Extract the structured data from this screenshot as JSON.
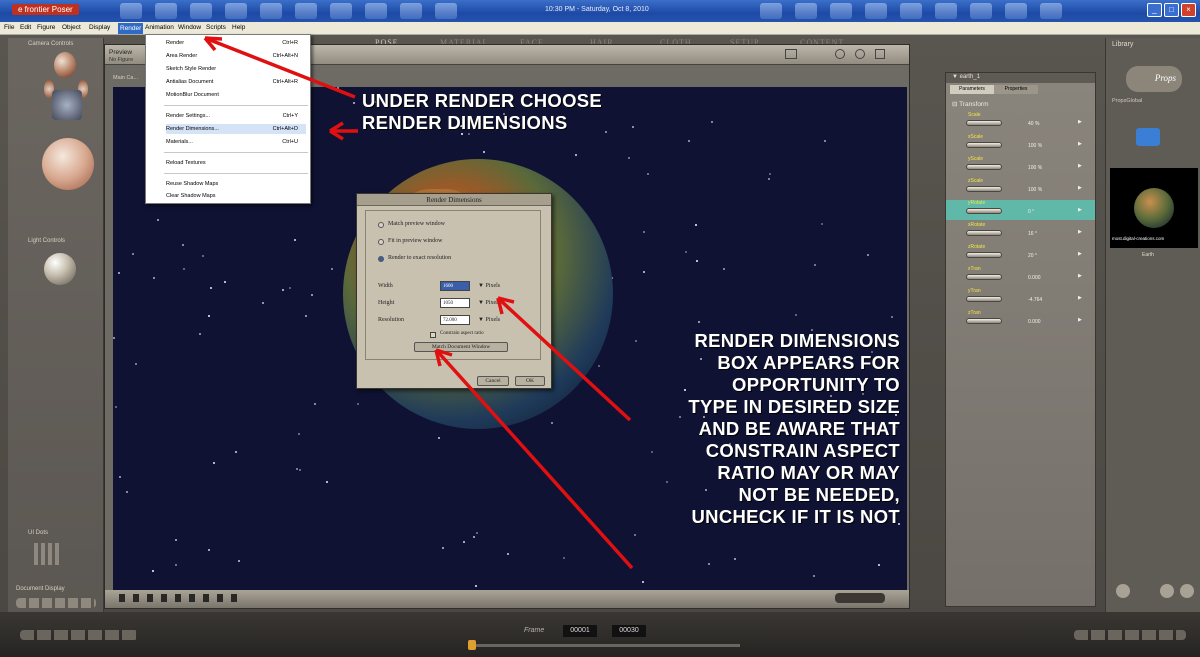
{
  "titlebar": {
    "title": "e frontier Poser",
    "clock": "10:30 PM - Saturday, Oct 8, 2010"
  },
  "menubar": {
    "items": [
      "File",
      "Edit",
      "Figure",
      "Object",
      "Display",
      "Render",
      "Animation",
      "Window",
      "Scripts",
      "Help"
    ]
  },
  "room_tabs": [
    "POSE",
    "MATERIAL",
    "FACE",
    "HAIR",
    "CLOTH",
    "SETUP",
    "CONTENT"
  ],
  "left_panel": {
    "camera_controls": "Camera Controls",
    "light_controls": "Light Controls",
    "ui_dots": "UI Dots",
    "document_display": "Document Display"
  },
  "document": {
    "tab": "Preview",
    "sub": "No Figure",
    "camera": "Main Ca..."
  },
  "render_menu": {
    "items": [
      {
        "label": "Render",
        "shortcut": "Ctrl+R"
      },
      {
        "label": "Area Render",
        "shortcut": "Ctrl+Alt+N"
      },
      {
        "label": "Sketch Style Render",
        "shortcut": ""
      },
      {
        "label": "Antialias Document",
        "shortcut": "Ctrl+Alt+R"
      },
      {
        "label": "MotionBlur Document",
        "shortcut": ""
      },
      {
        "label": "Render Settings...",
        "shortcut": "Ctrl+Y"
      },
      {
        "label": "Render Dimensions...",
        "shortcut": "Ctrl+Alt+D"
      },
      {
        "label": "Materials...",
        "shortcut": "Ctrl+U"
      },
      {
        "label": "Reload Textures",
        "shortcut": ""
      },
      {
        "label": "Reuse Shadow Maps",
        "shortcut": ""
      },
      {
        "label": "Clear Shadow Maps",
        "shortcut": ""
      }
    ]
  },
  "dialog": {
    "title": "Render Dimensions",
    "opt_match": "Match preview window",
    "opt_fit": "Fit in preview window",
    "opt_exact": "Render to exact resolution",
    "width_label": "Width",
    "width_value": "1600",
    "height_label": "Height",
    "height_value": "1050",
    "resolution_label": "Resolution",
    "resolution_value": "72.000",
    "unit_pixels": "Pixels",
    "unit_res": "Pixels",
    "constrain": "Constrain aspect ratio",
    "match_btn": "Match Document Window",
    "cancel": "Cancel",
    "ok": "OK"
  },
  "param_panel": {
    "object": "earth_1",
    "tab_params": "Parameters",
    "tab_props": "Properties",
    "group": "Transform",
    "dials": [
      {
        "name": "Scale",
        "value": "40 %"
      },
      {
        "name": "xScale",
        "value": "100 %"
      },
      {
        "name": "yScale",
        "value": "100 %"
      },
      {
        "name": "zScale",
        "value": "100 %"
      },
      {
        "name": "yRotate",
        "value": "0 °"
      },
      {
        "name": "xRotate",
        "value": "16 °"
      },
      {
        "name": "zRotate",
        "value": "20 °"
      },
      {
        "name": "xTran",
        "value": "0.000"
      },
      {
        "name": "yTran",
        "value": "-4.764"
      },
      {
        "name": "zTran",
        "value": "0.000"
      }
    ]
  },
  "library": {
    "title": "Library",
    "category": "Props",
    "subcat": "PropsGlobal",
    "thumb_label": "most.digital-creations.com",
    "thumb_name": "Earth"
  },
  "timeline": {
    "frame_label": "Frame",
    "frame_cur": "00001",
    "frame_total": "00030"
  },
  "annotations": {
    "a1": [
      "UNDER RENDER CHOOSE",
      "RENDER DIMENSIONS"
    ],
    "a2": [
      "RENDER DIMENSIONS",
      "BOX APPEARS FOR",
      "OPPORTUNITY TO",
      "TYPE IN DESIRED SIZE",
      "AND BE AWARE THAT",
      "CONSTRAIN ASPECT",
      "RATIO MAY OR MAY",
      "NOT BE NEEDED,",
      "UNCHECK IF IT IS NOT"
    ],
    "color": "#ffffff",
    "arrow_color": "#e01010"
  }
}
